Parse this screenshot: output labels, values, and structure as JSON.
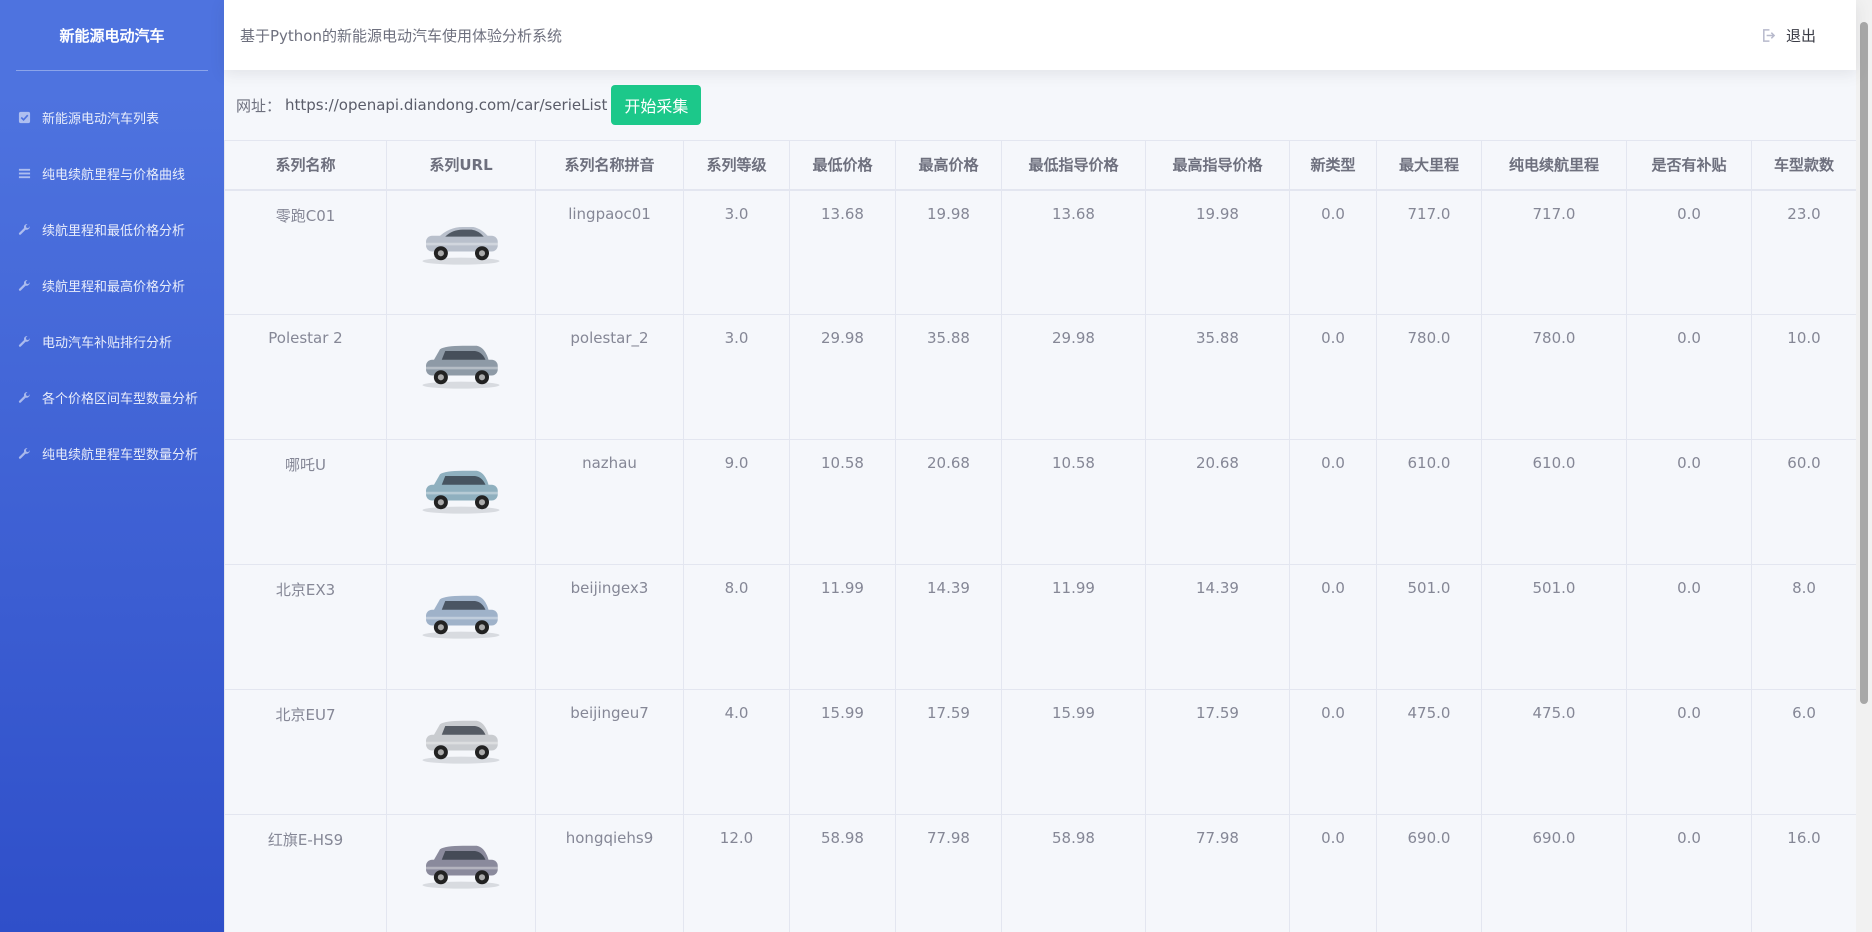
{
  "sidebar": {
    "brand": "新能源电动汽车",
    "items": [
      {
        "label": "新能源电动汽车列表",
        "icon": "check-square-icon"
      },
      {
        "label": "纯电续航里程与价格曲线",
        "icon": "list-icon"
      },
      {
        "label": "续航里程和最低价格分析",
        "icon": "wrench-icon"
      },
      {
        "label": "续航里程和最高价格分析",
        "icon": "wrench-icon"
      },
      {
        "label": "电动汽车补贴排行分析",
        "icon": "wrench-icon"
      },
      {
        "label": "各个价格区间车型数量分析",
        "icon": "wrench-icon"
      },
      {
        "label": "纯电续航里程车型数量分析",
        "icon": "wrench-icon"
      }
    ]
  },
  "header": {
    "title": "基于Python的新能源电动汽车使用体验分析系统",
    "logout_label": "退出",
    "logout_icon": "sign-out-icon"
  },
  "url_bar": {
    "label": "网址：",
    "value": "https://openapi.diandong.com/car/serieList",
    "start_button": "开始采集"
  },
  "table": {
    "columns": [
      "系列名称",
      "系列URL",
      "系列名称拼音",
      "系列等级",
      "最低价格",
      "最高价格",
      "最低指导价格",
      "最高指导价格",
      "新类型",
      "最大里程",
      "纯电续航里程",
      "是否有补贴",
      "车型款数"
    ],
    "rows": [
      {
        "name": "零跑C01",
        "car_color": "#b9c0cc",
        "shape": "sedan",
        "pinyin": "lingpaoc01",
        "level": "3.0",
        "min_price": "13.68",
        "max_price": "19.98",
        "min_guide": "13.68",
        "max_guide": "19.98",
        "new_type": "0.0",
        "max_range": "717.0",
        "ev_range": "717.0",
        "subsidy": "0.0",
        "model_count": "23.0"
      },
      {
        "name": "Polestar 2",
        "car_color": "#8e9aa6",
        "shape": "suv",
        "pinyin": "polestar_2",
        "level": "3.0",
        "min_price": "29.98",
        "max_price": "35.88",
        "min_guide": "29.98",
        "max_guide": "35.88",
        "new_type": "0.0",
        "max_range": "780.0",
        "ev_range": "780.0",
        "subsidy": "0.0",
        "model_count": "10.0"
      },
      {
        "name": "哪吒U",
        "car_color": "#8fb0bf",
        "shape": "suv",
        "pinyin": "nazhau",
        "level": "9.0",
        "min_price": "10.58",
        "max_price": "20.68",
        "min_guide": "10.58",
        "max_guide": "20.68",
        "new_type": "0.0",
        "max_range": "610.0",
        "ev_range": "610.0",
        "subsidy": "0.0",
        "model_count": "60.0"
      },
      {
        "name": "北京EX3",
        "car_color": "#9fb2c9",
        "shape": "suv",
        "pinyin": "beijingex3",
        "level": "8.0",
        "min_price": "11.99",
        "max_price": "14.39",
        "min_guide": "11.99",
        "max_guide": "14.39",
        "new_type": "0.0",
        "max_range": "501.0",
        "ev_range": "501.0",
        "subsidy": "0.0",
        "model_count": "8.0"
      },
      {
        "name": "北京EU7",
        "car_color": "#c9ccd0",
        "shape": "suv",
        "pinyin": "beijingeu7",
        "level": "4.0",
        "min_price": "15.99",
        "max_price": "17.59",
        "min_guide": "15.99",
        "max_guide": "17.59",
        "new_type": "0.0",
        "max_range": "475.0",
        "ev_range": "475.0",
        "subsidy": "0.0",
        "model_count": "6.0"
      },
      {
        "name": "红旗E-HS9",
        "car_color": "#8a8a9c",
        "shape": "suv",
        "pinyin": "hongqiehs9",
        "level": "12.0",
        "min_price": "58.98",
        "max_price": "77.98",
        "min_guide": "58.98",
        "max_guide": "77.98",
        "new_type": "0.0",
        "max_range": "690.0",
        "ev_range": "690.0",
        "subsidy": "0.0",
        "model_count": "16.0"
      }
    ]
  }
}
